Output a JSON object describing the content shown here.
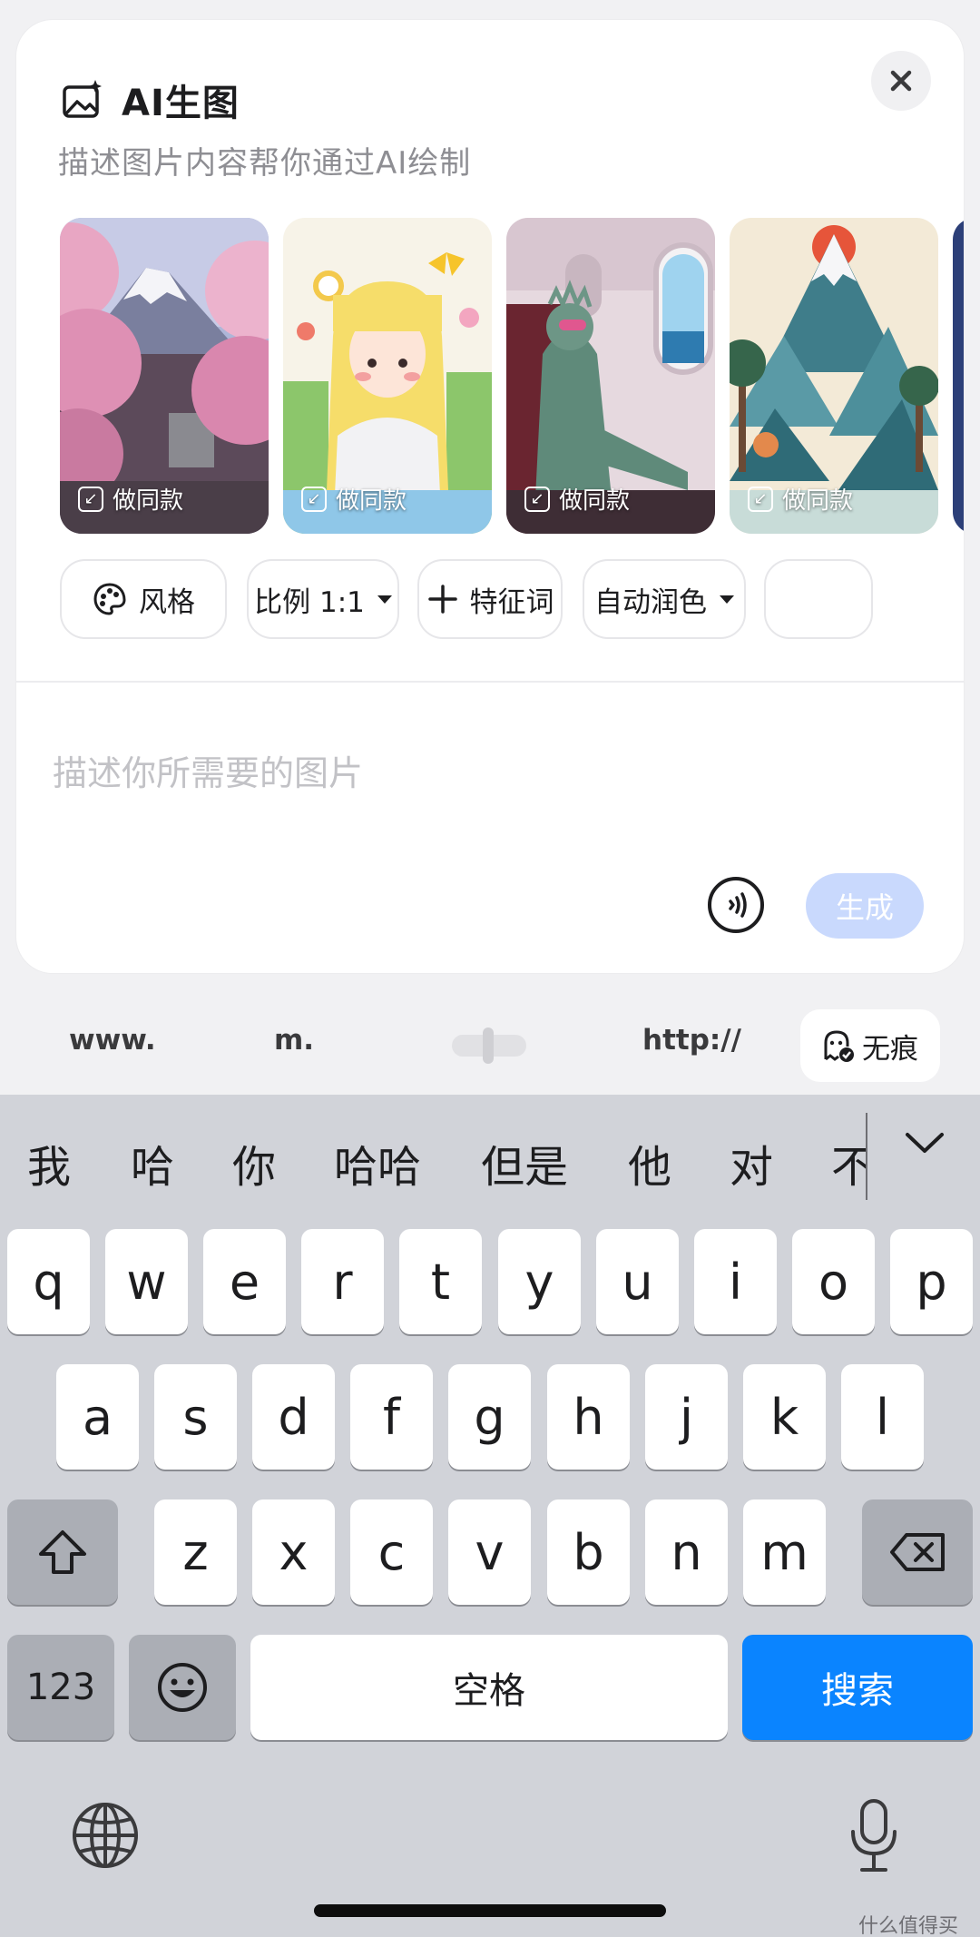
{
  "header": {
    "title": "AI生图",
    "subtitle": "描述图片内容帮你通过AI绘制"
  },
  "gallery": {
    "items": [
      {
        "label": "做同款",
        "theme": "mount-fuji-cherry-blossoms"
      },
      {
        "label": "做同款",
        "theme": "blonde-girl-flowers-butterfly"
      },
      {
        "label": "做同款",
        "theme": "statue-of-liberty-on-airplane"
      },
      {
        "label": "做同款",
        "theme": "chinese-landscape-mountains"
      }
    ]
  },
  "chips": {
    "style": "风格",
    "ratio": "比例 1:1",
    "features": "特征词",
    "auto_color": "自动润色"
  },
  "prompt": {
    "placeholder": "描述你所需要的图片",
    "value": ""
  },
  "actions": {
    "generate": "生成"
  },
  "accessory": {
    "www": "www.",
    "m": "m.",
    "http": "http://",
    "incognito": "无痕"
  },
  "keyboard": {
    "candidates": [
      "我",
      "哈",
      "你",
      "哈哈",
      "但是",
      "他",
      "对",
      "不"
    ],
    "row1": [
      "q",
      "w",
      "e",
      "r",
      "t",
      "y",
      "u",
      "i",
      "o",
      "p"
    ],
    "row2": [
      "a",
      "s",
      "d",
      "f",
      "g",
      "h",
      "j",
      "k",
      "l"
    ],
    "row3": [
      "z",
      "x",
      "c",
      "v",
      "b",
      "n",
      "m"
    ],
    "numbers": "123",
    "space": "空格",
    "search": "搜索"
  },
  "watermark": "什么值得买",
  "colors": {
    "accent_blue": "#0a84ff",
    "generate_disabled": "#c9d9fd"
  }
}
